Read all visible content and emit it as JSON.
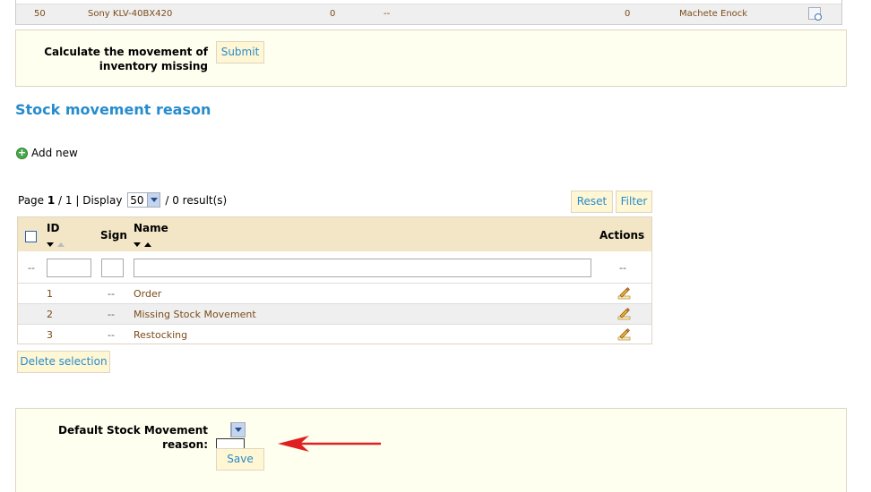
{
  "top_row": {
    "id": "50",
    "product": "Sony KLV-40BX420",
    "col3": "0",
    "col4": "--",
    "col5": "0",
    "employee": "Machete Enock"
  },
  "calc_panel": {
    "label_line1": "Calculate the movement of",
    "label_line2": "inventory missing",
    "submit_label": "Submit"
  },
  "section_title": "Stock movement reason",
  "add_new_label": "Add new",
  "pager": {
    "page_prefix": "Page ",
    "page_current": "1",
    "page_sep": " / 1 | Display ",
    "display_value": "50",
    "results": " / 0 result(s)"
  },
  "buttons": {
    "reset": "Reset",
    "filter": "Filter",
    "delete_selection": "Delete selection",
    "save": "Save"
  },
  "table": {
    "headers": {
      "id": "ID",
      "sign": "Sign",
      "name": "Name",
      "actions": "Actions"
    },
    "filter_placeholder_dash": "--",
    "filter_actions_dash": "--",
    "rows": [
      {
        "id": "1",
        "sign": "--",
        "name": "Order"
      },
      {
        "id": "2",
        "sign": "--",
        "name": "Missing Stock Movement"
      },
      {
        "id": "3",
        "sign": "--",
        "name": "Restocking"
      }
    ]
  },
  "default_panel": {
    "label_line1": "Default Stock Movement",
    "label_line2": "reason:"
  },
  "colors": {
    "accent_blue": "#268ccd",
    "panel_bg": "#fffff0",
    "header_bg": "#f3e6c6",
    "arrow_red": "#e02020"
  }
}
